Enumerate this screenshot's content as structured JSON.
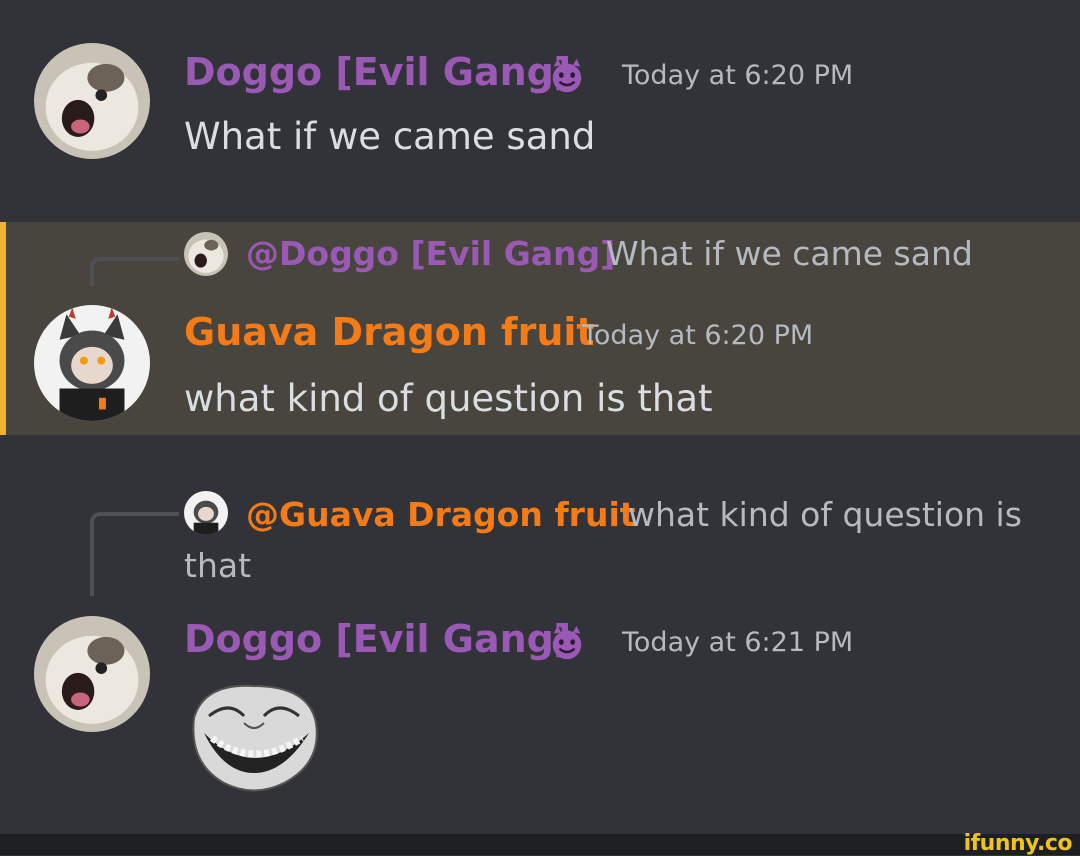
{
  "messages": [
    {
      "author": "Doggo [Evil Gang]",
      "author_color": "#9b59b6",
      "badge_icon": "smiling-imp-emoji",
      "timestamp": "Today at 6:20 PM",
      "text": "What if we came sand"
    },
    {
      "reply_to": {
        "mention": "@Doggo [Evil Gang]",
        "text": "What if we came sand",
        "mention_color": "#9b59b6"
      },
      "author": "Guava Dragon fruit",
      "author_color": "#f47b16",
      "timestamp": "Today at 6:20 PM",
      "text": "what kind of question is that",
      "highlighted": true,
      "highlight_color": "#f0b232"
    },
    {
      "reply_to": {
        "mention": "@Guava Dragon fruit",
        "text_line1": "what kind of question is",
        "text_line2": "that",
        "mention_color": "#f47b16"
      },
      "author": "Doggo [Evil Gang]",
      "author_color": "#9b59b6",
      "badge_icon": "smiling-imp-emoji",
      "timestamp": "Today at 6:21 PM",
      "attachment": "trollface-image"
    }
  ],
  "watermark": "ifunny.co"
}
